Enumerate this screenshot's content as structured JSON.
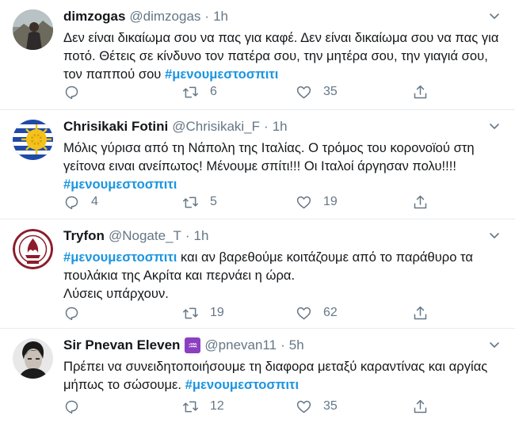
{
  "colors": {
    "hashtag": "#1b95e0",
    "muted": "#657786",
    "divider": "#e6ecf0"
  },
  "tweets": [
    {
      "name": "dimzogas",
      "handle": "@dimzogas",
      "time": "1h",
      "text_parts": [
        "Δεν είναι δικαίωμα σου να πας για καφέ. Δεν είναι δικαίωμα σου να πας για ποτό. Θέτεις σε κίνδυνο τον πατέρα σου, την μητέρα σου, την γιαγιά σου, τον παππού σου "
      ],
      "hashtag": "#μενουμεστοσπιτι",
      "replies": "",
      "retweets": "6",
      "likes": "35"
    },
    {
      "name": "Chrisikaki Fotini",
      "handle": "@Chrisikaki_F",
      "time": "1h",
      "text_parts": [
        "Μόλις γύρισα από τη Νάπολη της Ιταλίας.  Ο τρόμος του κορονοϊού στη γείτονα ειναι ανείπωτος! Μένουμε σπίτι!!! Οι Ιταλοί άργησαν πολυ!!!!"
      ],
      "hashtag": "#μενουμεστοσπιτι",
      "replies": "4",
      "retweets": "5",
      "likes": "19"
    },
    {
      "name": "Tryfon",
      "handle": "@Nogate_T",
      "time": "1h",
      "hashtag": "#μενουμεστοσπιτι",
      "text_parts": [
        " και αν βαρεθούμε κοιτάζουμε από το παράθυρο τα πουλάκια της Ακρίτα και περνάει η ώρα.",
        "Λύσεις υπάρχουν."
      ],
      "replies": "",
      "retweets": "19",
      "likes": "62"
    },
    {
      "name": "Sir Pnevan Eleven",
      "badge": "♒",
      "handle": "@pnevan11",
      "time": "5h",
      "text_parts": [
        "Πρέπει να συνειδητοποιήσουμε τη διαφορα μεταξύ καραντίνας και αργίας μήπως το σώσουμε. "
      ],
      "hashtag": "#μενουμεστοσπιτι",
      "replies": "",
      "retweets": "12",
      "likes": "35"
    }
  ]
}
